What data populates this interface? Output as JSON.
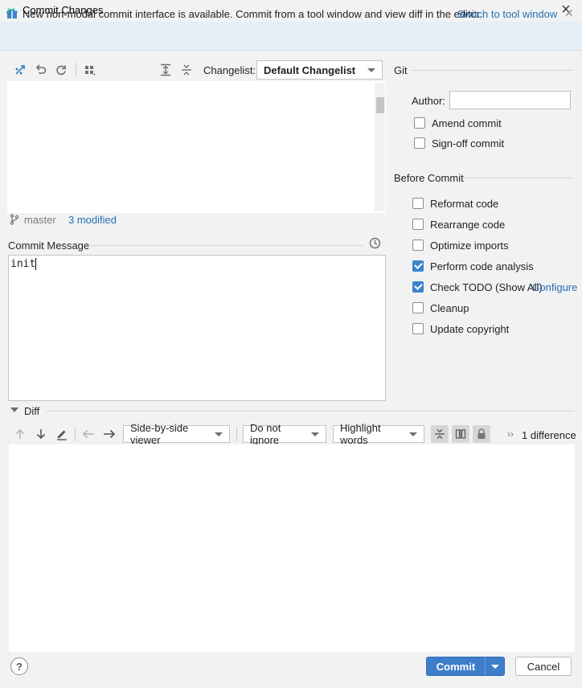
{
  "window": {
    "title": "Commit Changes"
  },
  "banner": {
    "text": "New non-modal commit interface is available. Commit from a tool window and view diff in the editor.",
    "link": "Switch to tool window"
  },
  "toolbar": {
    "changelist_label": "Changelist:",
    "changelist_value": "Default Changelist"
  },
  "status": {
    "branch": "master",
    "modified": "3 modified"
  },
  "commit_message": {
    "label": "Commit Message",
    "value": "init"
  },
  "git": {
    "title": "Git",
    "author_label": "Author:",
    "author_value": "",
    "options": [
      {
        "label": "Amend commit",
        "checked": false
      },
      {
        "label": "Sign-off commit",
        "checked": false
      }
    ]
  },
  "before_commit": {
    "title": "Before Commit",
    "options": [
      {
        "label": "Reformat code",
        "checked": false
      },
      {
        "label": "Rearrange code",
        "checked": false
      },
      {
        "label": "Optimize imports",
        "checked": false
      },
      {
        "label": "Perform code analysis",
        "checked": true
      },
      {
        "label": "Check TODO (Show All)",
        "checked": true
      },
      {
        "label": "Cleanup",
        "checked": false
      },
      {
        "label": "Update copyright",
        "checked": false
      }
    ],
    "configure_link": "Configure"
  },
  "diff": {
    "title": "Diff",
    "viewer": "Side-by-side viewer",
    "ignore": "Do not ignore",
    "highlight": "Highlight words",
    "count": "1 difference"
  },
  "buttons": {
    "help": "?",
    "commit": "Commit",
    "cancel": "Cancel"
  },
  "colors": {
    "accent": "#3d7ecb",
    "link": "#2470b3",
    "banner_bg": "#e6eef7"
  }
}
